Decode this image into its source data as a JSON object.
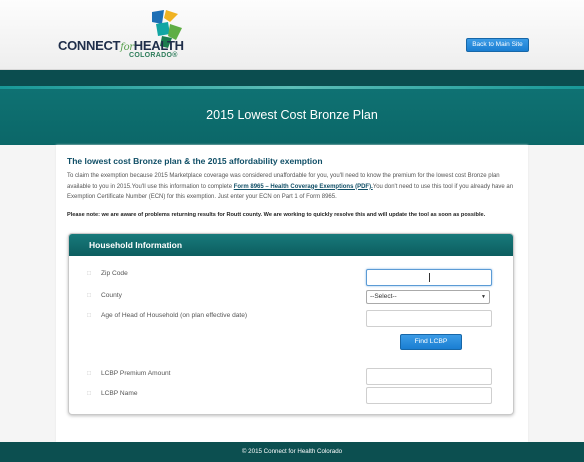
{
  "header": {
    "logo_text_connect": "CONNECT",
    "logo_text_for": "for",
    "logo_text_health": "HEALTH",
    "logo_sub": "COLORADO®",
    "back_button": "Back to Main Site"
  },
  "page": {
    "title": "2015 Lowest Cost Bronze Plan"
  },
  "intro": {
    "heading": "The lowest cost Bronze plan & the 2015 affordability exemption",
    "text_before_link": "To claim the exemption because 2015 Marketplace coverage was considered unaffordable for you, you'll need to know the premium for the lowest cost Bronze plan available to you in 2015.You'll use this information to complete ",
    "link": "Form 8965 – Health Coverage Exemptions (PDF).",
    "text_after_link": "You don't need to use this tool if you already have an Exemption Certificate Number (ECN) for this exemption. Just enter your ECN on Part 1 of Form 8965.",
    "notice": "Please note: we are aware of problems returning results for Routt county. We are working to quickly resolve this and will update the tool as soon as possible."
  },
  "form": {
    "title": "Household Information",
    "zip_label": "Zip Code",
    "zip_value": "",
    "county_label": "County",
    "county_selected": "--Select--",
    "age_label": "Age of Head of Household (on plan effective date)",
    "age_value": "",
    "find_button": "Find LCBP",
    "premium_label": "LCBP Premium Amount",
    "premium_value": "",
    "name_label": "LCBP Name",
    "name_value": "",
    "row_marker": "□"
  },
  "footer": {
    "text": "© 2015 Connect for Health Colorado"
  },
  "colors": {
    "teal_dark": "#0b4d4f",
    "teal": "#0f7273",
    "button_blue": "#1a7ed2",
    "heading_blue": "#0f4e66"
  }
}
